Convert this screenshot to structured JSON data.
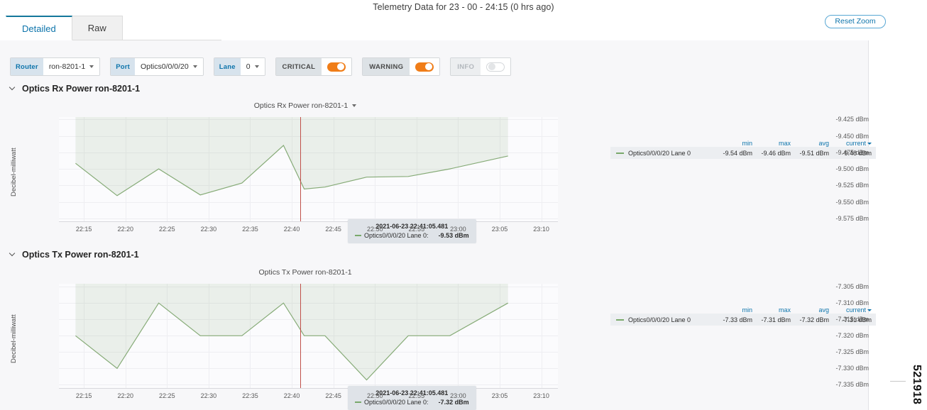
{
  "header": {
    "title": "Telemetry Data for 23 - 00 - 24:15 (0 hrs ago)",
    "reset_zoom_label": "Reset Zoom"
  },
  "tabs": [
    {
      "label": "Detailed",
      "active": true
    },
    {
      "label": "Raw",
      "active": false
    }
  ],
  "filters": {
    "router": {
      "label": "Router",
      "value": "ron-8201-1"
    },
    "port": {
      "label": "Port",
      "value": "Optics0/0/0/20"
    },
    "lane": {
      "label": "Lane",
      "value": "0"
    },
    "toggles": [
      {
        "label": "CRITICAL",
        "state": "on"
      },
      {
        "label": "WARNING",
        "state": "on"
      },
      {
        "label": "INFO",
        "state": "off"
      }
    ]
  },
  "sections": [
    {
      "heading": "Optics Rx Power ron-8201-1"
    },
    {
      "heading": "Optics Tx Power ron-8201-1"
    }
  ],
  "legend_headers": [
    "min",
    "max",
    "avg",
    "current"
  ],
  "figure_id": "521918",
  "chart_data": [
    {
      "type": "area",
      "title": "Optics Rx Power ron-8201-1",
      "has_title_caret": true,
      "xlabel": "",
      "ylabel": "Decibel-milliwatt",
      "yticks": [
        "-9.425 dBm",
        "-9.450 dBm",
        "-9.475 dBm",
        "-9.500 dBm",
        "-9.525 dBm",
        "-9.550 dBm",
        "-9.575 dBm"
      ],
      "ytickvalues": [
        -9.425,
        -9.45,
        -9.475,
        -9.5,
        -9.525,
        -9.55,
        -9.575
      ],
      "ylim": [
        -9.5805,
        -9.4215
      ],
      "xticks": [
        "22:15",
        "22:20",
        "22:25",
        "22:30",
        "22:35",
        "22:40",
        "22:45",
        "22:50",
        "22:55",
        "23:00",
        "23:05",
        "23:10"
      ],
      "xlim": [
        132.0,
        192.0
      ],
      "series": [
        {
          "name": "Optics0/0/0/20 Lane 0",
          "color": "#86ab77",
          "x": [
            134.0,
            139.0,
            144.0,
            149.0,
            154.0,
            159.0,
            161.5,
            164.0,
            169.0,
            174.0,
            179.0,
            186.0
          ],
          "values": [
            -9.4915,
            -9.5405,
            -9.5,
            -9.5395,
            -9.5215,
            -9.4645,
            -9.5305,
            -9.5275,
            -9.5125,
            -9.5115,
            -9.5,
            -9.4805
          ]
        }
      ],
      "marker_time": "22:41",
      "tooltip": {
        "time": "2021-06-23 22:41:05.481",
        "series_label": "Optics0/0/0/20 Lane 0:",
        "value": "-9.53 dBm"
      },
      "legend": {
        "name": "Optics0/0/0/20 Lane 0",
        "min": "-9.54 dBm",
        "max": "-9.46 dBm",
        "avg": "-9.51 dBm",
        "current": "-9.48 dBm"
      }
    },
    {
      "type": "area",
      "title": "Optics Tx Power ron-8201-1",
      "has_title_caret": false,
      "xlabel": "",
      "ylabel": "Decibel-milliwatt",
      "yticks": [
        "-7.305 dBm",
        "-7.310 dBm",
        "-7.315 dBm",
        "-7.320 dBm",
        "-7.325 dBm",
        "-7.330 dBm",
        "-7.335 dBm"
      ],
      "ytickvalues": [
        -7.305,
        -7.31,
        -7.315,
        -7.32,
        -7.325,
        -7.33,
        -7.335
      ],
      "ylim": [
        -7.3362,
        -7.3041
      ],
      "xticks": [
        "22:15",
        "22:20",
        "22:25",
        "22:30",
        "22:35",
        "22:40",
        "22:45",
        "22:50",
        "22:55",
        "23:00",
        "23:05",
        "23:10"
      ],
      "xlim": [
        132.0,
        192.0
      ],
      "series": [
        {
          "name": "Optics0/0/0/20 Lane 0",
          "color": "#86ab77",
          "x": [
            134.0,
            139.0,
            144.0,
            149.0,
            154.0,
            159.0,
            161.5,
            164.0,
            169.0,
            174.0,
            179.0,
            186.0
          ],
          "values": [
            -7.32,
            -7.33,
            -7.31,
            -7.32,
            -7.32,
            -7.31,
            -7.32,
            -7.32,
            -7.3335,
            -7.32,
            -7.32,
            -7.31
          ]
        }
      ],
      "marker_time": "22:41",
      "tooltip": {
        "time": "2021-06-23 22:41:05.481",
        "series_label": "Optics0/0/0/20 Lane 0:",
        "value": "-7.32 dBm"
      },
      "legend": {
        "name": "Optics0/0/0/20 Lane 0",
        "min": "-7.33 dBm",
        "max": "-7.31 dBm",
        "avg": "-7.32 dBm",
        "current": "-7.31 dBm"
      }
    }
  ]
}
